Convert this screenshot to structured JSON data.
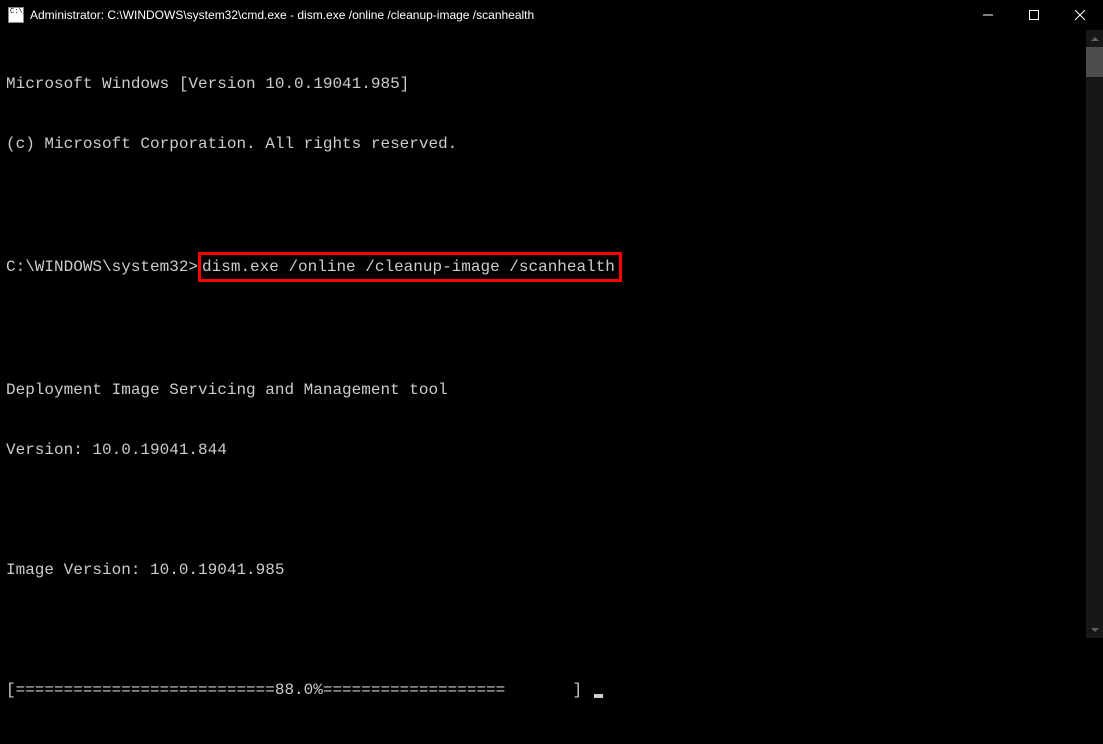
{
  "titlebar": {
    "title": "Administrator: C:\\WINDOWS\\system32\\cmd.exe - dism.exe  /online /cleanup-image /scanhealth"
  },
  "terminal": {
    "line1": "Microsoft Windows [Version 10.0.19041.985]",
    "line2": "(c) Microsoft Corporation. All rights reserved.",
    "blank1": "",
    "prompt_prefix": "C:\\WINDOWS\\system32>",
    "command": "dism.exe /online /cleanup-image /scanhealth",
    "blank2": "",
    "tool_line": "Deployment Image Servicing and Management tool",
    "version_line": "Version: 10.0.19041.844",
    "blank3": "",
    "image_version": "Image Version: 10.0.19041.985",
    "blank4": "",
    "progress": "[===========================88.0%===================       ] ",
    "blank5": ""
  }
}
